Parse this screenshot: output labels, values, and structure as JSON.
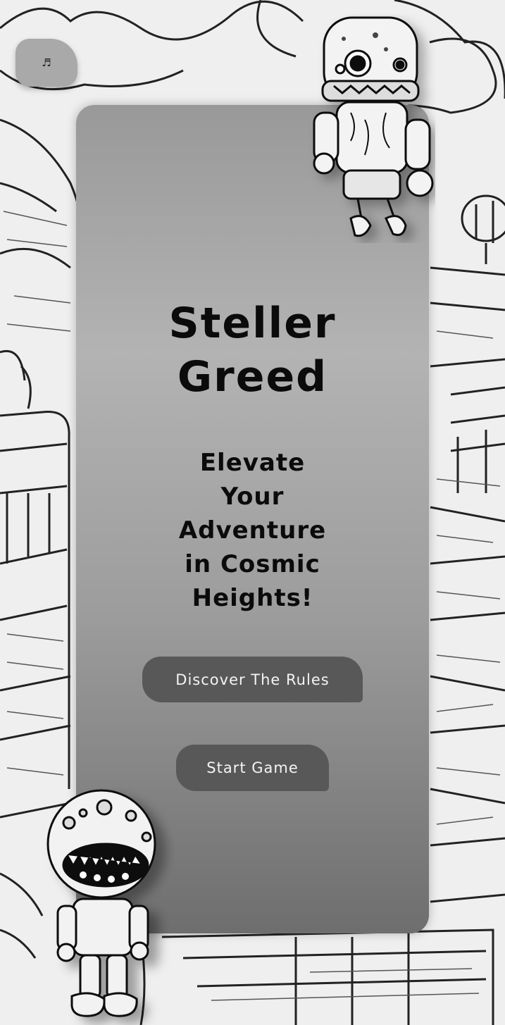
{
  "music": {
    "icon": "music-note-icon",
    "glyph": "♬"
  },
  "title": {
    "line1": "Steller",
    "line2": "Greed"
  },
  "tagline": [
    "Elevate",
    "Your",
    "Adventure",
    "in Cosmic",
    "Heights!"
  ],
  "buttons": {
    "rules_label": "Discover The Rules",
    "start_label": "Start Game"
  },
  "colors": {
    "panel_top": "#999999",
    "panel_bottom": "#6e6e6e",
    "button": "#585858",
    "button_text": "#f4f4f4"
  }
}
